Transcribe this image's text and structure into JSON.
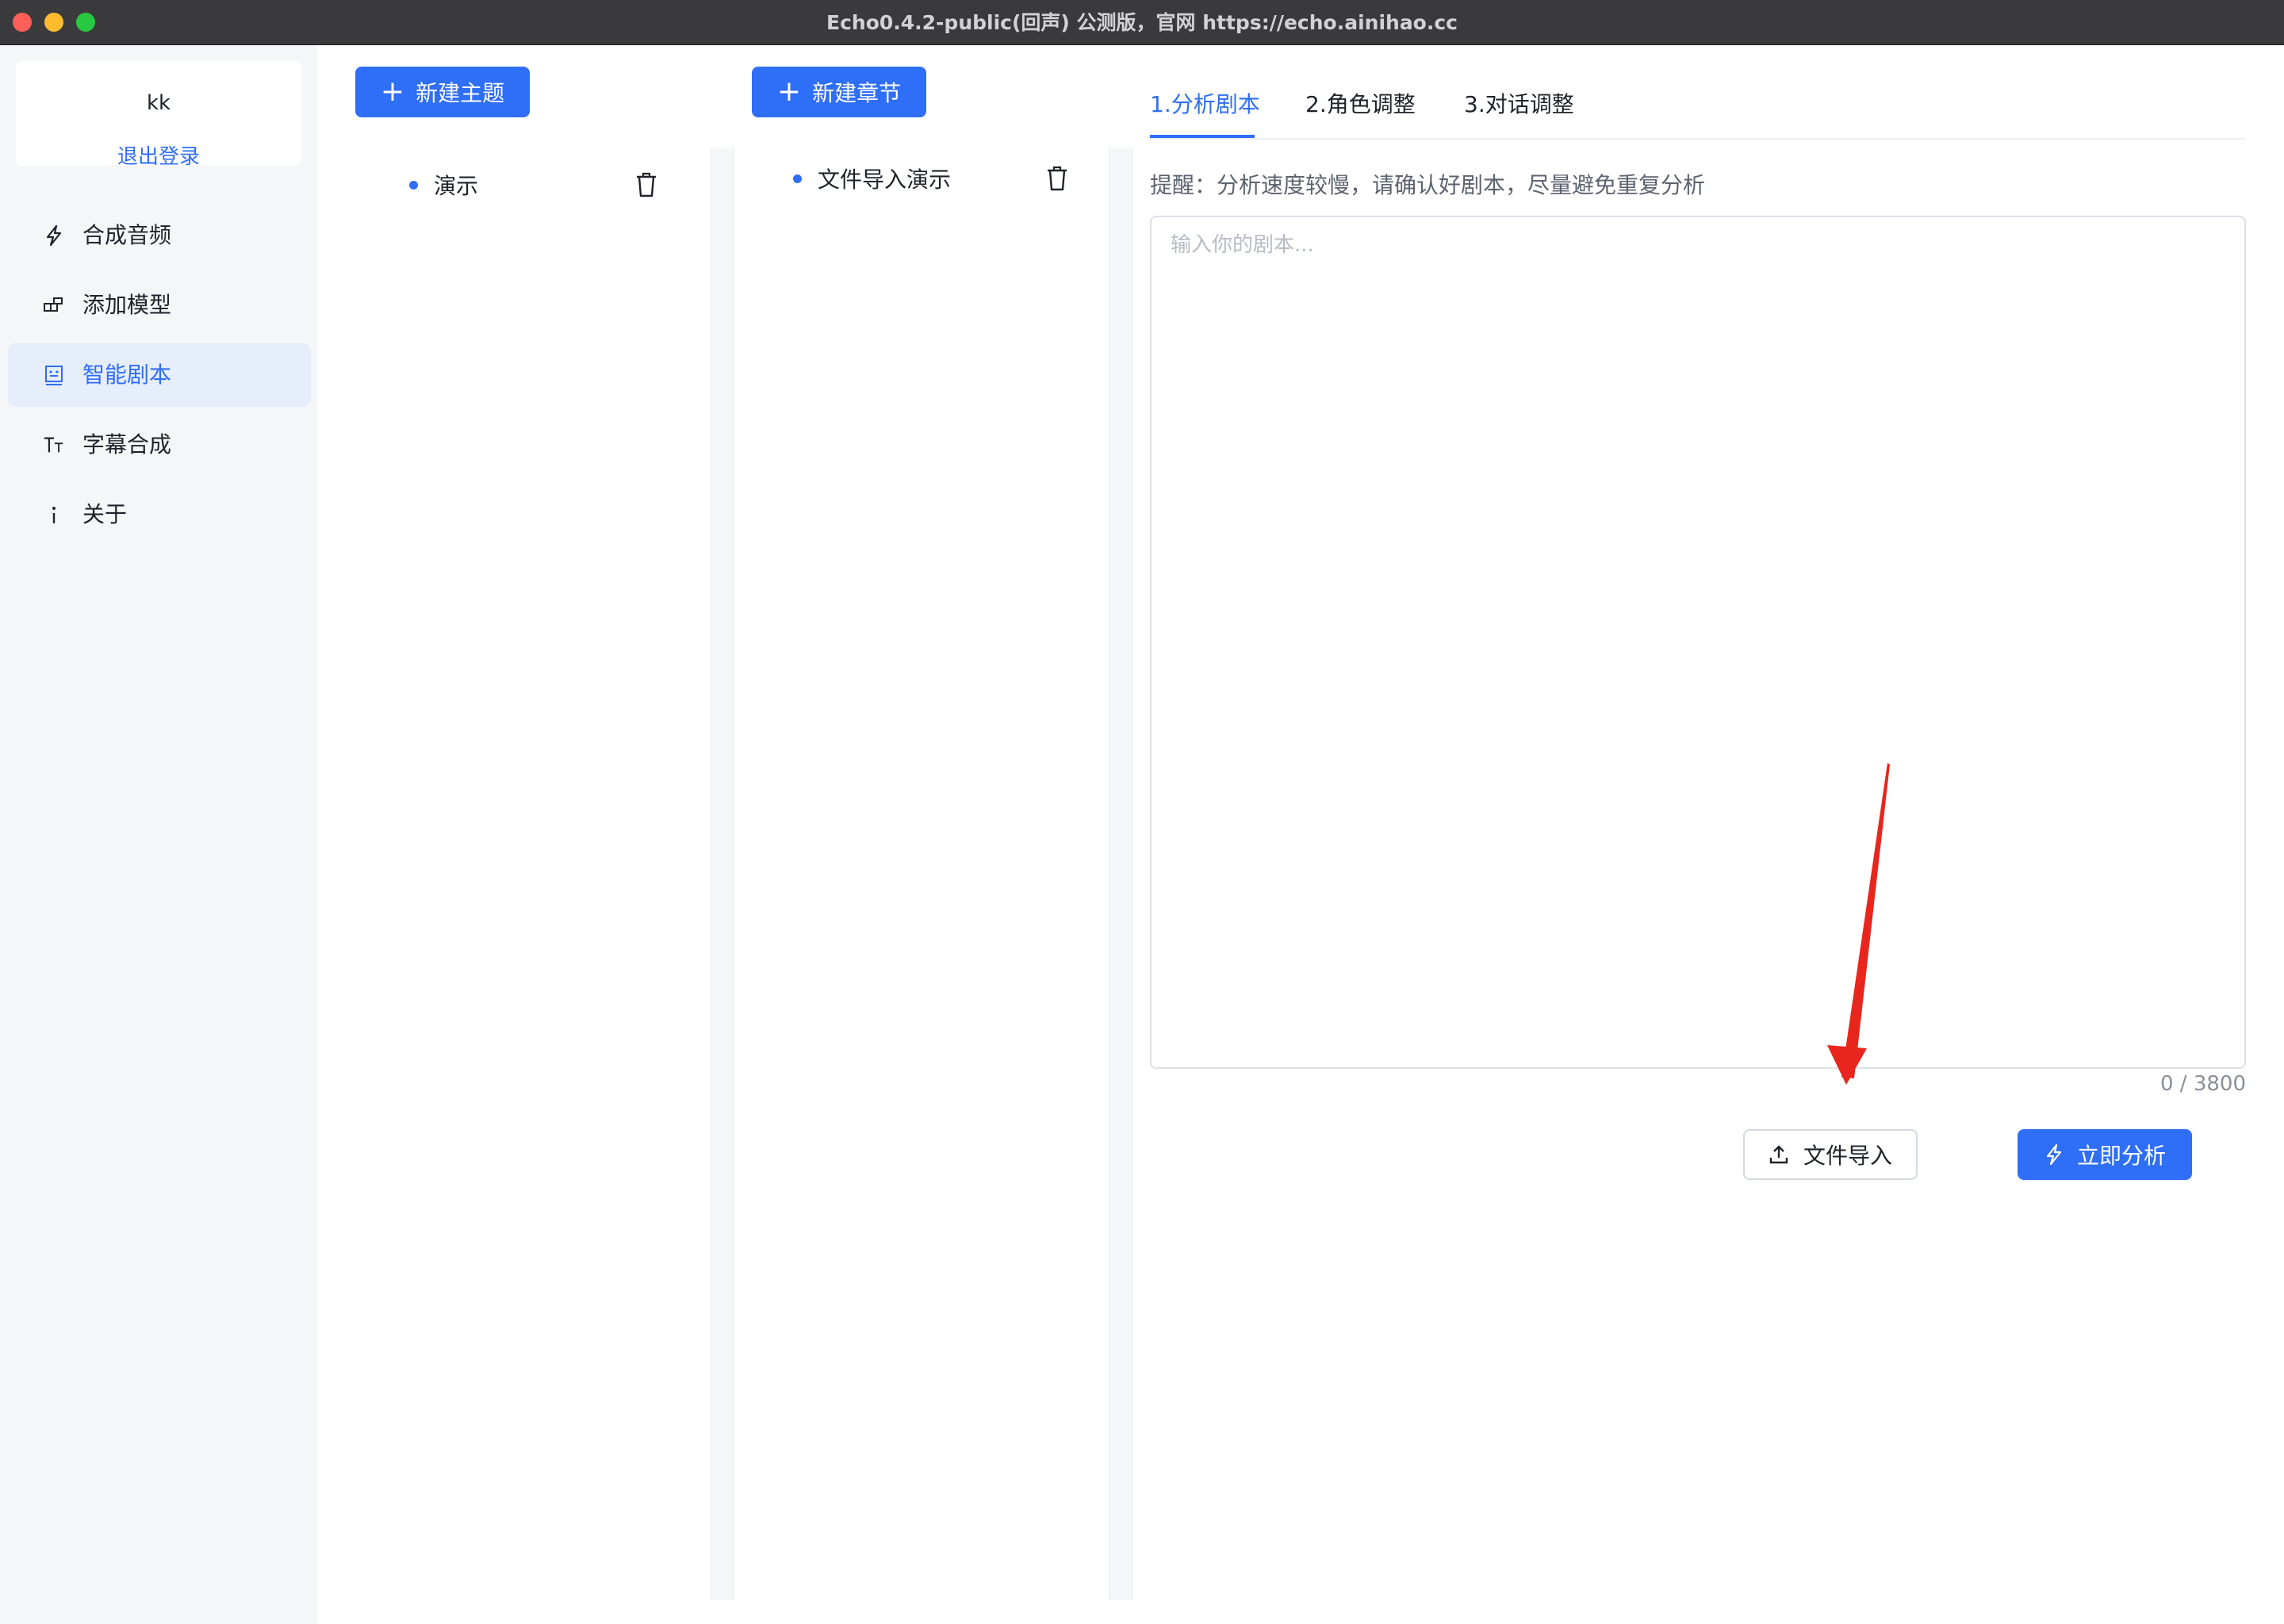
{
  "window": {
    "title": "Echo0.4.2-public(回声) 公测版，官网 https://echo.ainihao.cc"
  },
  "sidebar": {
    "user": {
      "name": "kk",
      "logout_label": "退出登录"
    },
    "items": [
      {
        "label": "合成音频",
        "icon": "lightning-icon",
        "active": false
      },
      {
        "label": "添加模型",
        "icon": "model-blocks-icon",
        "active": false
      },
      {
        "label": "智能剧本",
        "icon": "script-icon",
        "active": true
      },
      {
        "label": "字幕合成",
        "icon": "text-size-icon",
        "active": false
      },
      {
        "label": "关于",
        "icon": "info-icon",
        "active": false
      }
    ]
  },
  "topics": {
    "new_button_label": "新建主题",
    "items": [
      {
        "label": "演示"
      }
    ]
  },
  "chapters": {
    "new_button_label": "新建章节",
    "items": [
      {
        "label": "文件导入演示"
      }
    ]
  },
  "tabs": [
    {
      "label": "1.分析剧本",
      "active": true
    },
    {
      "label": "2.角色调整",
      "active": false
    },
    {
      "label": "3.对话调整",
      "active": false
    }
  ],
  "editor": {
    "notice": "提醒：分析速度较慢，请确认好剧本，尽量避免重复分析",
    "placeholder": "输入你的剧本...",
    "value": "",
    "counter": "0 / 3800",
    "import_button_label": "文件导入",
    "analyze_button_label": "立即分析"
  },
  "colors": {
    "accent": "#2f6ef6",
    "annotation_arrow": "#e8261d"
  }
}
